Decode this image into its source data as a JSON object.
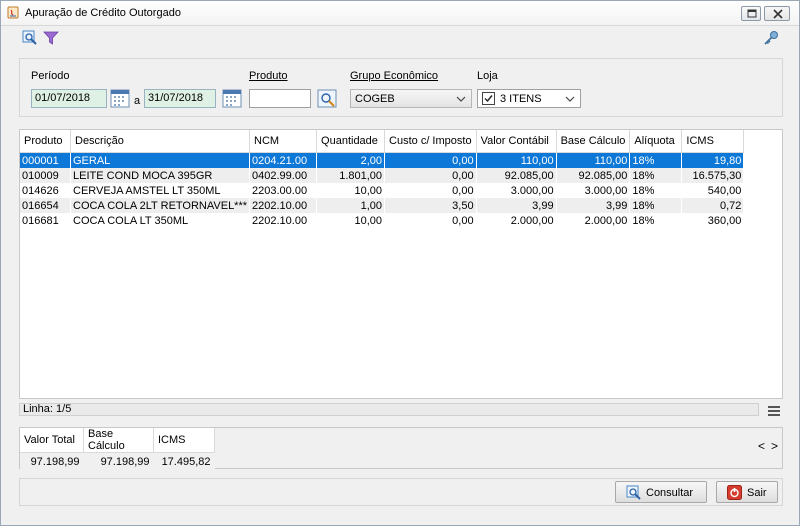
{
  "window": {
    "title": "Apuração de Crédito Outorgado"
  },
  "toolbar": {
    "icons": [
      "search-icon",
      "filter-icon",
      "key-icon"
    ]
  },
  "filters": {
    "periodo_label": "Período",
    "date_from": "01/07/2018",
    "date_sep": "a",
    "date_to": "31/07/2018",
    "produto_label": "Produto",
    "produto_value": "",
    "grupo_label": "Grupo Econômico",
    "grupo_value": "COGEB",
    "loja_label": "Loja",
    "loja_value": "3 ITENS"
  },
  "table": {
    "columns": [
      "Produto",
      "Descrição",
      "NCM",
      "Quantidade",
      "Custo c/ Imposto",
      "Valor Contábil",
      "Base Cálculo",
      "Alíquota",
      "ICMS"
    ],
    "rows": [
      {
        "produto": "000001",
        "descricao": "GERAL",
        "ncm": "0204.21.00",
        "quantidade": "2,00",
        "custo": "0,00",
        "valor_contabil": "110,00",
        "base_calculo": "110,00",
        "aliquota": "18%",
        "icms": "19,80"
      },
      {
        "produto": "010009",
        "descricao": "LEITE COND MOCA 395GR",
        "ncm": "0402.99.00",
        "quantidade": "1.801,00",
        "custo": "0,00",
        "valor_contabil": "92.085,00",
        "base_calculo": "92.085,00",
        "aliquota": "18%",
        "icms": "16.575,30"
      },
      {
        "produto": "014626",
        "descricao": "CERVEJA AMSTEL LT 350ML",
        "ncm": "2203.00.00",
        "quantidade": "10,00",
        "custo": "0,00",
        "valor_contabil": "3.000,00",
        "base_calculo": "3.000,00",
        "aliquota": "18%",
        "icms": "540,00"
      },
      {
        "produto": "016654",
        "descricao": "COCA COLA 2LT RETORNAVEL***",
        "ncm": "2202.10.00",
        "quantidade": "1,00",
        "custo": "3,50",
        "valor_contabil": "3,99",
        "base_calculo": "3,99",
        "aliquota": "18%",
        "icms": "0,72"
      },
      {
        "produto": "016681",
        "descricao": "COCA COLA LT 350ML",
        "ncm": "2202.10.00",
        "quantidade": "10,00",
        "custo": "0,00",
        "valor_contabil": "2.000,00",
        "base_calculo": "2.000,00",
        "aliquota": "18%",
        "icms": "360,00"
      }
    ]
  },
  "status": {
    "linha": "Linha: 1/5"
  },
  "totals": {
    "columns": [
      "Valor Total",
      "Base Cálculo",
      "ICMS"
    ],
    "values": [
      "97.198,99",
      "97.198,99",
      "17.495,82"
    ]
  },
  "nav": {
    "prev": "<",
    "next": ">"
  },
  "buttons": {
    "consultar": "Consultar",
    "sair": "Sair"
  },
  "colors": {
    "selection": "#0d78d7",
    "date_field": "#dff1e4"
  }
}
